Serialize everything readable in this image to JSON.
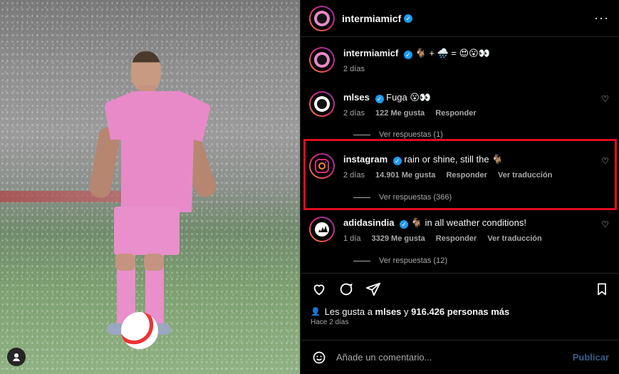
{
  "header": {
    "username": "intermiamicf",
    "verified_icon": "verified-badge",
    "more_label": "···"
  },
  "caption": {
    "username": "intermiamicf",
    "text": "🐐 + 🌧️ = 😍😮👀",
    "time": "2 días"
  },
  "comments": [
    {
      "username": "mlses",
      "text": "Fuga 😮👀",
      "time": "2 días",
      "likes": "122 Me gusta",
      "reply_label": "Responder",
      "view_replies": "Ver respuestas (1)"
    },
    {
      "username": "instagram",
      "text": "rain or shine, still the 🐐",
      "time": "2 días",
      "likes": "14.901 Me gusta",
      "reply_label": "Responder",
      "translate_label": "Ver traducción",
      "view_replies": "Ver respuestas (366)"
    },
    {
      "username": "adidasindia",
      "text": "🐐 in all weather conditions!",
      "time": "1 día",
      "likes": "3329 Me gusta",
      "reply_label": "Responder",
      "translate_label": "Ver traducción",
      "view_replies": "Ver respuestas (12)"
    }
  ],
  "likes_summary": {
    "prefix": "Les gusta a",
    "user": "mlses",
    "and_text": "y",
    "count_text": "916.426 personas más",
    "time": "Hace 2 días"
  },
  "composer": {
    "placeholder": "Añade un comentario...",
    "post_label": "Publicar"
  },
  "colors": {
    "accent": "#1d9bf0",
    "highlight": "#e00d1e",
    "background": "#000000"
  },
  "icons": {
    "like": "heart-icon",
    "comment": "comment-icon",
    "share": "share-icon",
    "save": "bookmark-icon",
    "emoji": "emoji-icon",
    "user": "user-icon",
    "more": "more-icon"
  }
}
